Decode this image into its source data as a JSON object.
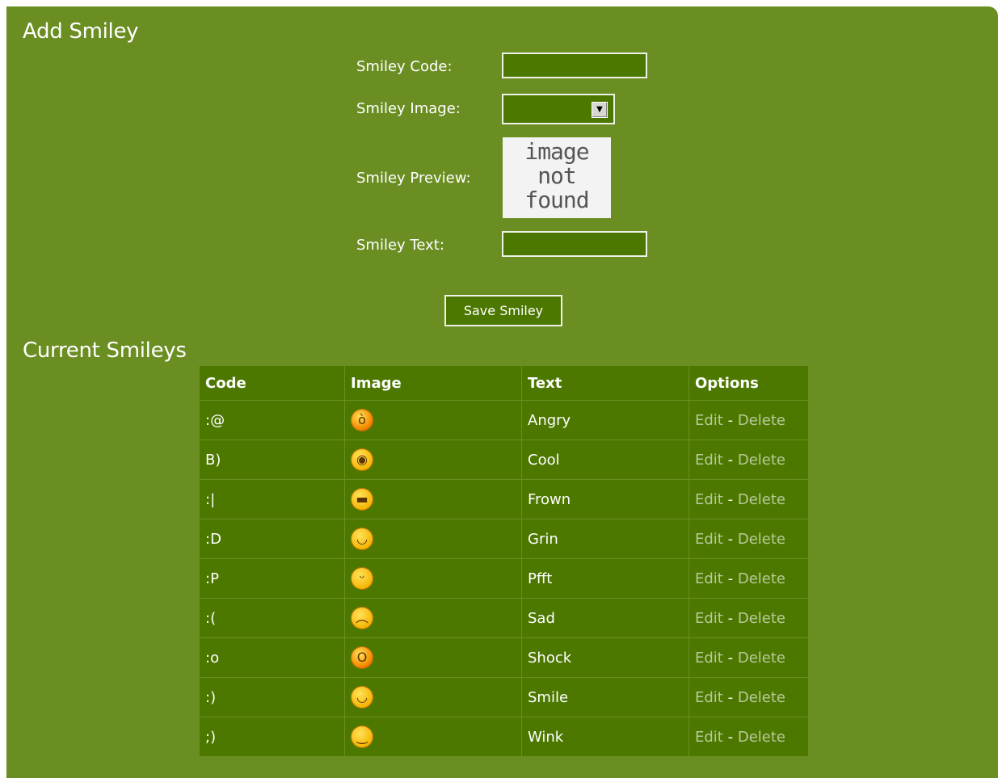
{
  "add_section": {
    "title": "Add Smiley",
    "code_label": "Smiley Code:",
    "code_value": "",
    "image_label": "Smiley Image:",
    "image_selected": "",
    "preview_label": "Smiley Preview:",
    "preview_placeholder": "image\nnot\nfound",
    "text_label": "Smiley Text:",
    "text_value": "",
    "save_label": "Save Smiley"
  },
  "list_section": {
    "title": "Current Smileys",
    "columns": [
      "Code",
      "Image",
      "Text",
      "Options"
    ],
    "edit_label": "Edit",
    "separator": "-",
    "delete_label": "Delete",
    "rows": [
      {
        "code": ":@",
        "icon": "angry-smiley-icon",
        "text": "Angry"
      },
      {
        "code": "B)",
        "icon": "cool-smiley-icon",
        "text": "Cool"
      },
      {
        "code": ":|",
        "icon": "frown-smiley-icon",
        "text": "Frown"
      },
      {
        "code": ":D",
        "icon": "grin-smiley-icon",
        "text": "Grin"
      },
      {
        "code": ":P",
        "icon": "pfft-smiley-icon",
        "text": "Pfft"
      },
      {
        "code": ":(",
        "icon": "sad-smiley-icon",
        "text": "Sad"
      },
      {
        "code": ":o",
        "icon": "shock-smiley-icon",
        "text": "Shock"
      },
      {
        "code": ":)",
        "icon": "smile-smiley-icon",
        "text": "Smile"
      },
      {
        "code": ";)",
        "icon": "wink-smiley-icon",
        "text": "Wink"
      }
    ]
  },
  "colors": {
    "panel_bg": "#6b8e23",
    "cell_bg": "#4d7800",
    "link": "#b8c99a"
  }
}
